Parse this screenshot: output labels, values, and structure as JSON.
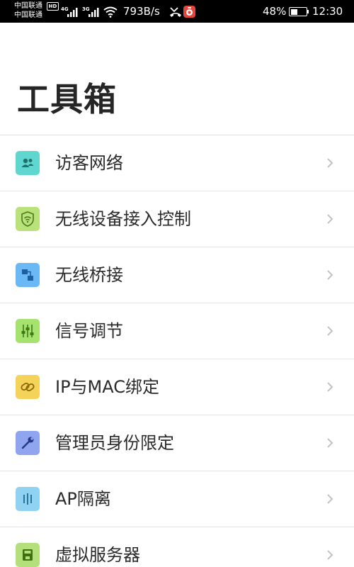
{
  "status_bar": {
    "carrier_1": "中国联通",
    "carrier_2": "中国联通",
    "hd_badge": "HD",
    "net_1": "4G",
    "net_2": "3G",
    "speed": "793B/s",
    "battery_percent": "48%",
    "battery_level": 0.48,
    "time": "12:30",
    "icons": [
      "hd-icon",
      "signal-icon",
      "wifi-icon",
      "missed-call-icon",
      "app-notification-icon",
      "battery-icon"
    ]
  },
  "page": {
    "title": "工具箱"
  },
  "tools": [
    {
      "label": "访客网络",
      "icon": "guest-network-icon",
      "color": "#5fd6d0"
    },
    {
      "label": "无线设备接入控制",
      "icon": "wireless-access-control-icon",
      "color": "#b9e27a"
    },
    {
      "label": "无线桥接",
      "icon": "wireless-bridge-icon",
      "color": "#6ab8f4"
    },
    {
      "label": "信号调节",
      "icon": "signal-adjust-icon",
      "color": "#a6e36e"
    },
    {
      "label": "IP与MAC绑定",
      "icon": "ip-mac-binding-icon",
      "color": "#f5d25a"
    },
    {
      "label": "管理员身份限定",
      "icon": "admin-restriction-icon",
      "color": "#8fa5f0"
    },
    {
      "label": "AP隔离",
      "icon": "ap-isolation-icon",
      "color": "#8fd2f2"
    },
    {
      "label": "虚拟服务器",
      "icon": "virtual-server-icon",
      "color": "#b3e07a"
    }
  ]
}
